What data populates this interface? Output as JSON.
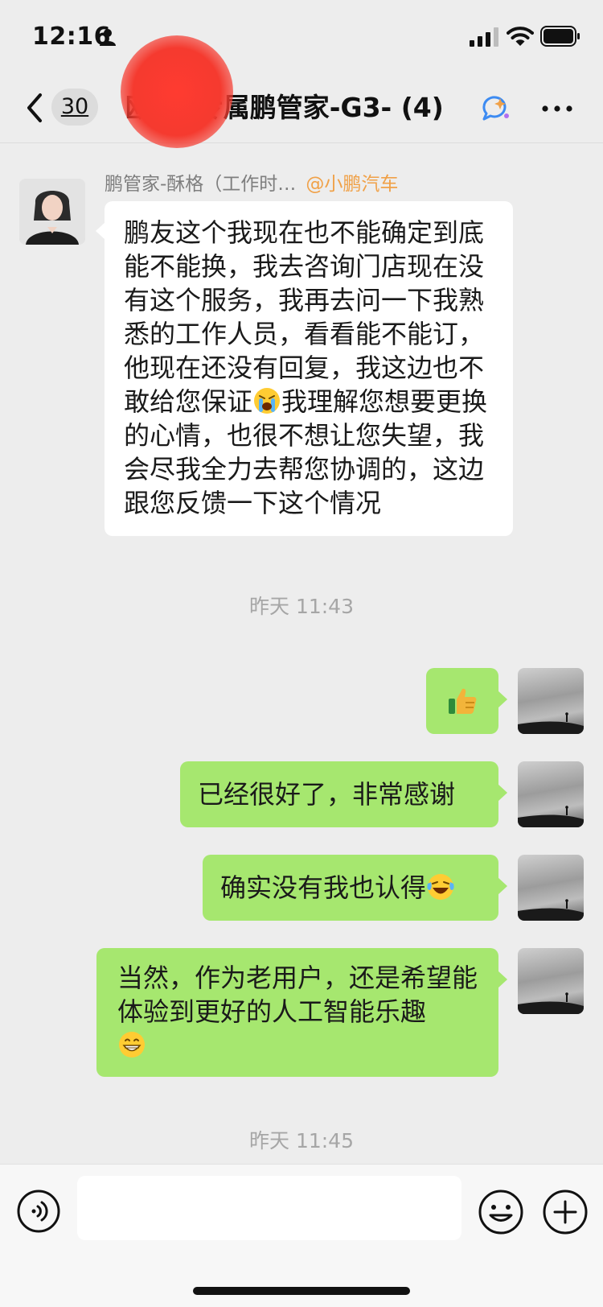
{
  "status_bar": {
    "time": "12:16",
    "icons": [
      "person-icon",
      "signal-icon",
      "wifi-icon",
      "battery-icon"
    ]
  },
  "nav": {
    "unread_count": "30",
    "title": "欧l 的专属鹏管家-G3- (4)",
    "icons": [
      "back-icon",
      "chat-ai-icon",
      "more-icon"
    ]
  },
  "messages": [
    {
      "direction": "incoming",
      "sender": "鹏管家-酥格（工作时…",
      "sender_tag": "@小鹏汽车",
      "text_before_emoji": "鹏友这个我现在也不能确定到底能不能换，我去咨询门店现在没有这个服务，我再去问一下我熟悉的工作人员，看看能不能订，他现在还没有回复，我这边也不敢给您保证",
      "emoji": "crying-face",
      "text_after_emoji": "我理解您想要更换的心情，也很不想让您失望，我会尽我全力去帮您协调的，这边跟您反馈一下这个情况"
    },
    {
      "direction": "outgoing",
      "emoji": "thumbs-up"
    },
    {
      "direction": "outgoing",
      "text": "已经很好了，非常感谢"
    },
    {
      "direction": "outgoing",
      "text": "确实没有我也认得",
      "emoji": "laughing-crying-face"
    },
    {
      "direction": "outgoing",
      "text": "当然，作为老用户，还是希望能体验到更好的人工智能乐趣",
      "emoji": "grinning-face"
    }
  ],
  "timestamps": [
    "昨天 11:43",
    "昨天 11:45"
  ],
  "input_bar": {
    "value": "",
    "icons": [
      "voice-icon",
      "emoji-icon",
      "plus-icon"
    ]
  },
  "colors": {
    "background": "#ededed",
    "incoming_bubble": "#ffffff",
    "outgoing_bubble": "#a6e76f",
    "sender_tag": "#f0a148",
    "timestamp": "#a6a6a6"
  }
}
